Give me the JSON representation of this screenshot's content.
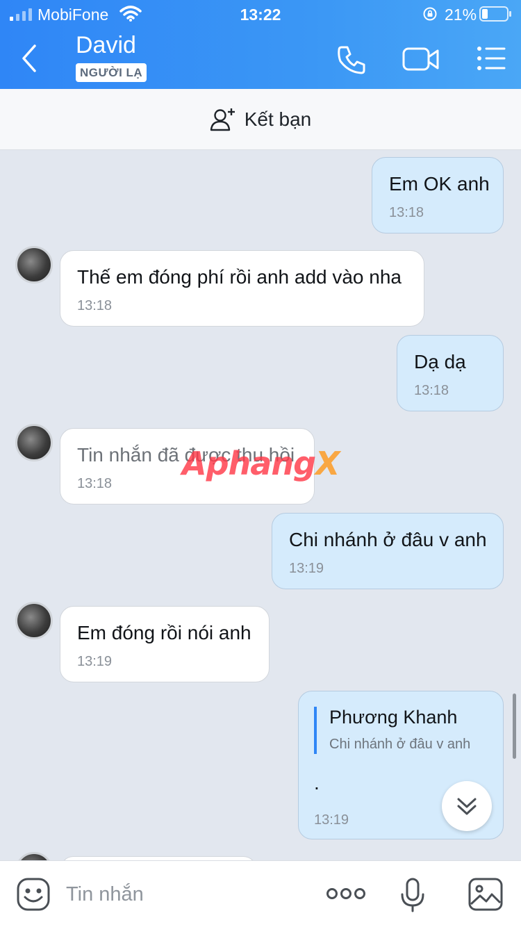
{
  "status_bar": {
    "carrier": "MobiFone",
    "time": "13:22",
    "battery": "21%"
  },
  "header": {
    "contact_name": "David",
    "badge": "NGƯỜI LẠ",
    "icons": [
      "back-icon",
      "phone-icon",
      "video-icon",
      "menu-icon"
    ]
  },
  "friend_bar": {
    "label": "Kết bạn"
  },
  "messages": [
    {
      "side": "out",
      "text": "Em OK anh",
      "time": "13:18"
    },
    {
      "side": "in",
      "text": "Thế em đóng phí rồi anh add vào nha",
      "time": "13:18"
    },
    {
      "side": "out",
      "text": "Dạ dạ",
      "time": "13:18"
    },
    {
      "side": "in",
      "text": "Tin nhắn đã được thu hồi",
      "time": "13:18"
    },
    {
      "side": "out",
      "text": "Chi nhánh ở đâu v anh",
      "time": "13:19"
    },
    {
      "side": "in",
      "text": "Em đóng rồi nói anh",
      "time": "13:19"
    },
    {
      "side": "out",
      "quote": {
        "name": "Phương Khanh",
        "text": "Chi nhánh ở đâu v anh"
      },
      "text": ".",
      "time": "13:19"
    }
  ],
  "watermark": {
    "main": "Aphang",
    "suffix": "X"
  },
  "input_bar": {
    "placeholder": "Tin nhắn"
  }
}
